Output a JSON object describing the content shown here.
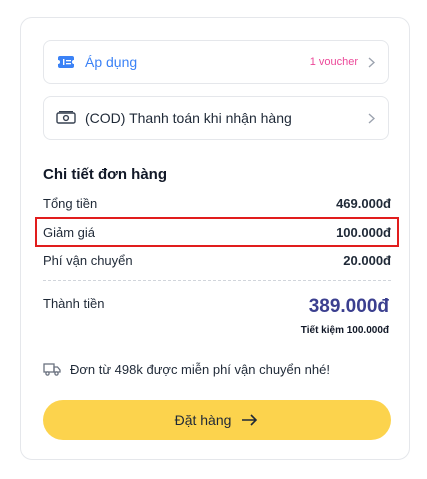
{
  "voucher": {
    "label": "Áp dụng",
    "count": "1 voucher",
    "icon": "ticket-icon"
  },
  "payment": {
    "label": "(COD) Thanh toán khi nhận hàng",
    "icon": "cash-icon"
  },
  "summary": {
    "title": "Chi tiết đơn hàng",
    "lines": [
      {
        "label": "Tổng tiền",
        "value": "469.000đ"
      },
      {
        "label": "Giảm giá",
        "value": "100.000đ"
      },
      {
        "label": "Phí vận chuyển",
        "value": "20.000đ"
      }
    ],
    "total_label": "Thành tiền",
    "total_value": "389.000đ",
    "savings": "Tiết kiệm 100.000đ"
  },
  "shipping_note": "Đơn từ 498k được miễn phí vận chuyển nhé!",
  "order_button": {
    "label": "Đặt hàng"
  },
  "colors": {
    "accent_blue": "#3b82f6",
    "voucher_pink": "#ec4899",
    "total_navy": "#3b3f8f",
    "button_yellow": "#fcd34d",
    "highlight_red": "#e11d1d"
  }
}
